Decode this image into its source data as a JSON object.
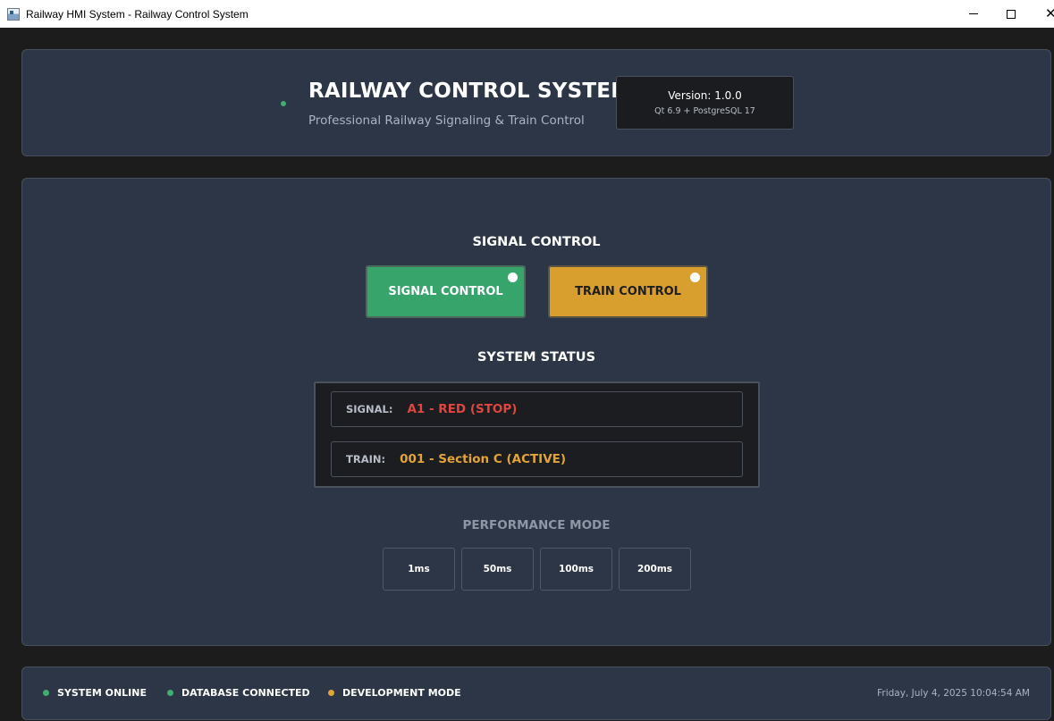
{
  "window": {
    "title": "Railway HMI System - Railway Control System",
    "minimize_glyph": "",
    "maximize_glyph": "",
    "close_glyph": "✕"
  },
  "header": {
    "title": "RAILWAY CONTROL SYSTEM",
    "subtitle": "Professional Railway Signaling & Train Control",
    "version_label": "Version: 1.0.0",
    "version_sub": "Qt 6.9 + PostgreSQL 17",
    "indicator_color": "#3fae6e"
  },
  "control": {
    "section_title": "SIGNAL CONTROL",
    "signal_button": "SIGNAL CONTROL",
    "train_button": "TRAIN CONTROL",
    "signal_color": "#36a46b",
    "train_color": "#d89f2f"
  },
  "system_status": {
    "section_title": "SYSTEM STATUS",
    "signal_label": "SIGNAL:",
    "signal_value": "A1 - RED (STOP)",
    "train_label": "TRAIN:",
    "train_value": "001 - Section C (ACTIVE)",
    "signal_value_color": "#e0453f",
    "train_value_color": "#e3a436"
  },
  "performance": {
    "section_title": "PERFORMANCE MODE",
    "options": [
      "1ms",
      "50ms",
      "100ms",
      "200ms"
    ]
  },
  "status_bar": {
    "items": [
      {
        "label": "SYSTEM ONLINE",
        "color": "#3fae6e"
      },
      {
        "label": "DATABASE CONNECTED",
        "color": "#3fae6e"
      },
      {
        "label": "DEVELOPMENT MODE",
        "color": "#e3a436"
      }
    ],
    "datetime": "Friday, July 4, 2025 10:04:54 AM"
  }
}
